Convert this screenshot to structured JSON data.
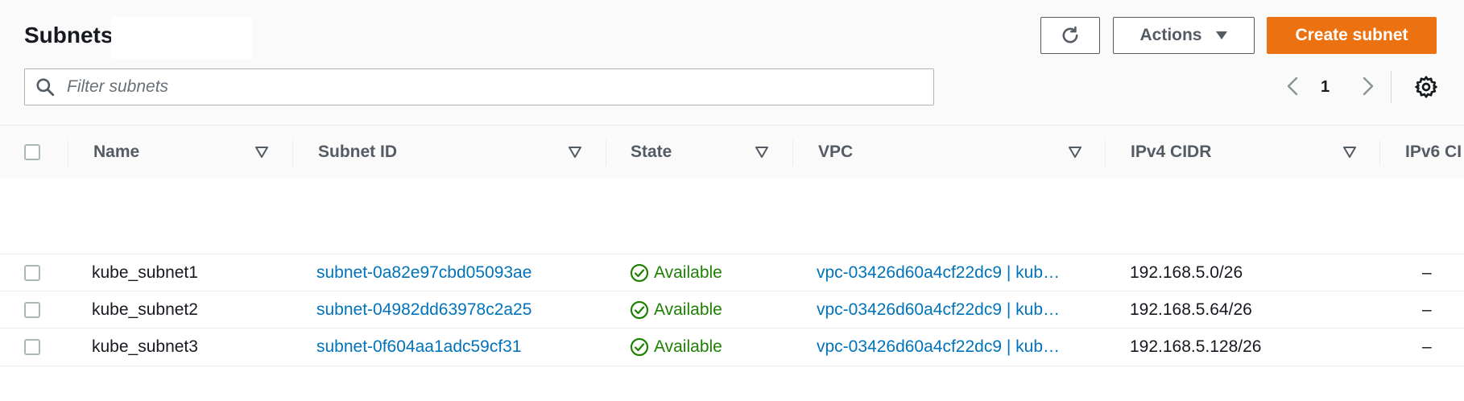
{
  "header": {
    "title": "Subnets",
    "actions_label": "Actions",
    "create_label": "Create subnet"
  },
  "search": {
    "placeholder": "Filter subnets"
  },
  "pagination": {
    "current_page": "1"
  },
  "columns": {
    "name": "Name",
    "subnet_id": "Subnet ID",
    "state": "State",
    "vpc": "VPC",
    "ipv4_cidr": "IPv4 CIDR",
    "ipv6_cidr": "IPv6 CI"
  },
  "rows": [
    {
      "name": "kube_subnet1",
      "subnet_id": "subnet-0a82e97cbd05093ae",
      "state": "Available",
      "vpc": "vpc-03426d60a4cf22dc9 | kub…",
      "ipv4": "192.168.5.0/26",
      "ipv6": "–"
    },
    {
      "name": "kube_subnet2",
      "subnet_id": "subnet-04982dd63978c2a25",
      "state": "Available",
      "vpc": "vpc-03426d60a4cf22dc9 | kub…",
      "ipv4": "192.168.5.64/26",
      "ipv6": "–"
    },
    {
      "name": "kube_subnet3",
      "subnet_id": "subnet-0f604aa1adc59cf31",
      "state": "Available",
      "vpc": "vpc-03426d60a4cf22dc9 | kub…",
      "ipv4": "192.168.5.128/26",
      "ipv6": "–"
    }
  ],
  "icons": {
    "refresh": "refresh-icon",
    "actions_caret": "caret-down-icon",
    "search": "search-icon",
    "prev": "chevron-left-icon",
    "next": "chevron-right-icon",
    "settings": "gear-icon",
    "sort": "sort-caret-icon",
    "status": "check-circle-icon"
  },
  "colors": {
    "primary_button": "#ec7211",
    "link": "#0073bb",
    "status_available": "#1d8102"
  }
}
